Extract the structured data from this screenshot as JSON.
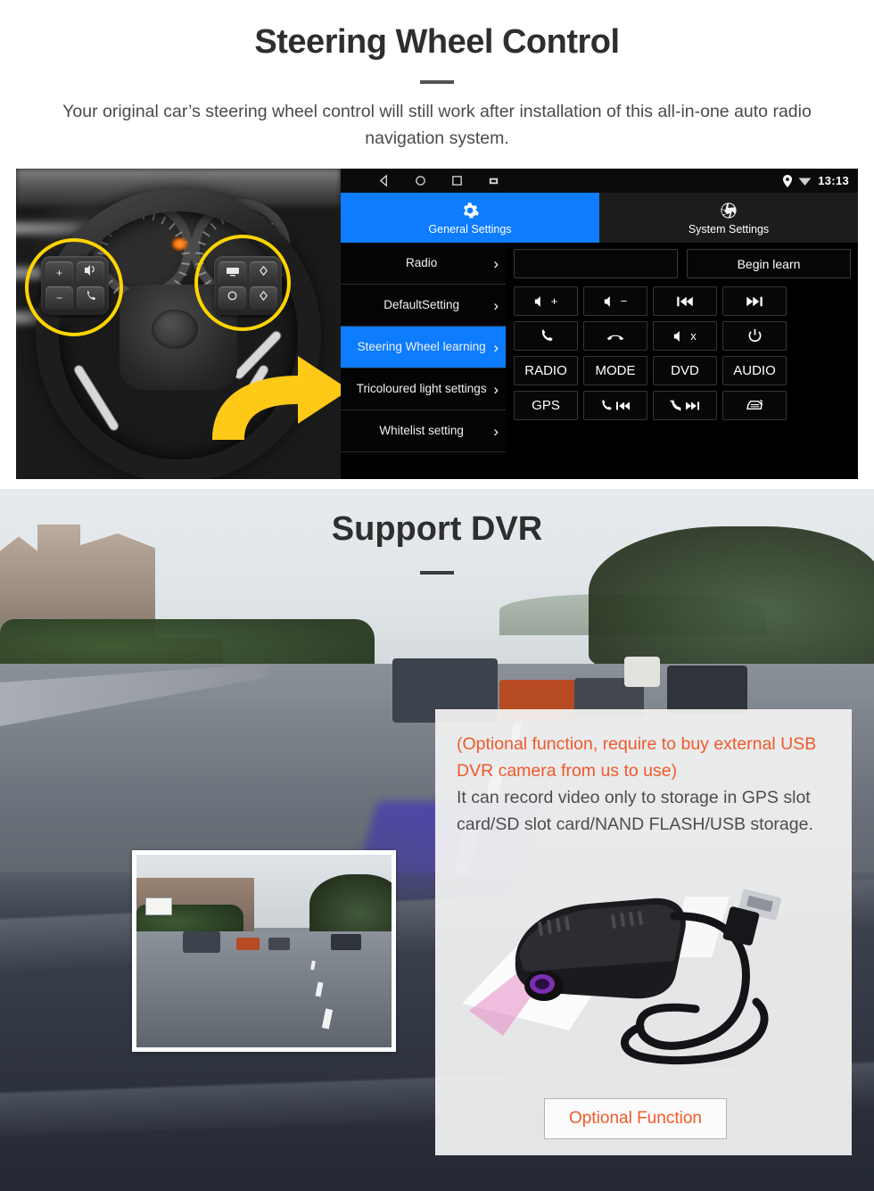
{
  "section1": {
    "title": "Steering Wheel Control",
    "subtitle": "Your original car’s steering wheel control will still work after installation of this all-in-one auto radio navigation system.",
    "android": {
      "statusbar": {
        "nav_icons": [
          "back-icon",
          "home-icon",
          "recents-icon",
          "screenshot-icon"
        ],
        "location_icon": "location-pin-icon",
        "wifi_icon": "wifi-icon",
        "clock": "13:13"
      },
      "tabs": [
        {
          "label": "General Settings",
          "icon": "gear-icon",
          "active": true
        },
        {
          "label": "System Settings",
          "icon": "aperture-icon",
          "active": false
        }
      ],
      "menu": [
        {
          "label": "Radio",
          "selected": false
        },
        {
          "label": "DefaultSetting",
          "selected": false
        },
        {
          "label": "Steering Wheel learning",
          "selected": true
        },
        {
          "label": "Tricoloured light settings",
          "selected": false
        },
        {
          "label": "Whitelist setting",
          "selected": false
        }
      ],
      "learn_panel": {
        "input_value": "",
        "begin_label": "Begin learn",
        "keys": [
          {
            "label": "",
            "icon": "volume-up-icon"
          },
          {
            "label": "",
            "icon": "volume-down-icon"
          },
          {
            "label": "",
            "icon": "previous-track-icon"
          },
          {
            "label": "",
            "icon": "next-track-icon"
          },
          {
            "label": "",
            "icon": "call-answer-icon"
          },
          {
            "label": "",
            "icon": "call-hangup-icon"
          },
          {
            "label": "",
            "icon": "mute-icon"
          },
          {
            "label": "",
            "icon": "power-icon"
          },
          {
            "label": "RADIO",
            "icon": ""
          },
          {
            "label": "MODE",
            "icon": ""
          },
          {
            "label": "DVD",
            "icon": ""
          },
          {
            "label": "AUDIO",
            "icon": ""
          },
          {
            "label": "GPS",
            "icon": ""
          },
          {
            "label": "",
            "icon": "call-previous-icon"
          },
          {
            "label": "",
            "icon": "call-reject-next-icon"
          },
          {
            "label": "",
            "icon": "rear-camera-icon"
          }
        ]
      }
    },
    "photo": {
      "highlight_color": "#FFD400",
      "left_pad_buttons": [
        "+",
        "−",
        "voice-icon",
        "call-icon"
      ],
      "right_pad_buttons": [
        "display-icon",
        "up-icon",
        "circle-icon",
        "down-icon"
      ]
    }
  },
  "section2": {
    "title": "Support DVR",
    "note_accent": "(Optional function, require to buy external USB DVR camera from us to use)",
    "note_body": "It can record video only to storage in GPS slot card/SD slot card/NAND FLASH/USB storage.",
    "optional_button": "Optional Function",
    "accent_color": "#f1592a"
  }
}
